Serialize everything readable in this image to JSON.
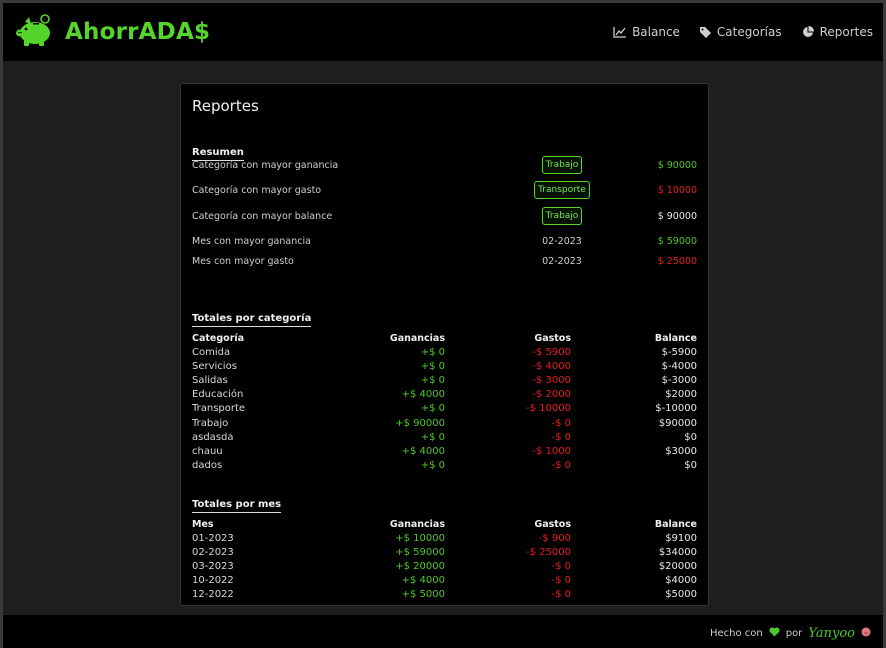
{
  "brand": {
    "title": "AhorrADA$",
    "logo_icon": "piggy-bank-icon"
  },
  "nav": {
    "items": [
      {
        "label": "Balance",
        "icon": "chart-line-icon"
      },
      {
        "label": "Categorías",
        "icon": "tag-icon"
      },
      {
        "label": "Reportes",
        "icon": "pie-chart-icon"
      }
    ]
  },
  "page": {
    "title": "Reportes"
  },
  "resumen": {
    "title": "Resumen",
    "rows": [
      {
        "label": "Categoría con mayor ganancia",
        "tag": "Trabajo",
        "value": "$ 90000",
        "color": "green"
      },
      {
        "label": "Categoría con mayor gasto",
        "tag": "Transporte",
        "value": "$ 10000",
        "color": "red"
      },
      {
        "label": "Categoría con mayor balance",
        "tag": "Trabajo",
        "value": "$ 90000",
        "color": "white"
      },
      {
        "label": "Mes con mayor ganancia",
        "month": "02-2023",
        "value": "$ 59000",
        "color": "green"
      },
      {
        "label": "Mes con mayor gasto",
        "month": "02-2023",
        "value": "$ 25000",
        "color": "red"
      }
    ]
  },
  "por_categoria": {
    "title": "Totales por categoría",
    "headers": [
      "Categoría",
      "Ganancias",
      "Gastos",
      "Balance"
    ],
    "rows": [
      [
        "Comida",
        "+$ 0",
        "-$ 5900",
        "$-5900"
      ],
      [
        "Servicios",
        "+$ 0",
        "-$ 4000",
        "$-4000"
      ],
      [
        "Salidas",
        "+$ 0",
        "-$ 3000",
        "$-3000"
      ],
      [
        "Educación",
        "+$ 4000",
        "-$ 2000",
        "$2000"
      ],
      [
        "Transporte",
        "+$ 0",
        "-$ 10000",
        "$-10000"
      ],
      [
        "Trabajo",
        "+$ 90000",
        "-$ 0",
        "$90000"
      ],
      [
        "asdasda",
        "+$ 0",
        "-$ 0",
        "$0"
      ],
      [
        "chauu",
        "+$ 4000",
        "-$ 1000",
        "$3000"
      ],
      [
        "dados",
        "+$ 0",
        "-$ 0",
        "$0"
      ]
    ]
  },
  "por_mes": {
    "title": "Totales por mes",
    "headers": [
      "Mes",
      "Ganancias",
      "Gastos",
      "Balance"
    ],
    "rows": [
      [
        "01-2023",
        "+$ 10000",
        "-$ 900",
        "$9100"
      ],
      [
        "02-2023",
        "+$ 59000",
        "-$ 25000",
        "$34000"
      ],
      [
        "03-2023",
        "+$ 20000",
        "-$ 0",
        "$20000"
      ],
      [
        "10-2022",
        "+$ 4000",
        "-$ 0",
        "$4000"
      ],
      [
        "12-2022",
        "+$ 5000",
        "-$ 0",
        "$5000"
      ]
    ]
  },
  "footer": {
    "made_with": "Hecho con",
    "by": "por",
    "author": "Yanyoo",
    "heart_icon": "heart-icon",
    "emoji_icon": "pig-face-icon"
  },
  "colors": {
    "accent": "#55d42b",
    "positive": "#4fc82a",
    "negative": "#e81e1e",
    "background": "#1e1e1e",
    "card": "#000000"
  }
}
